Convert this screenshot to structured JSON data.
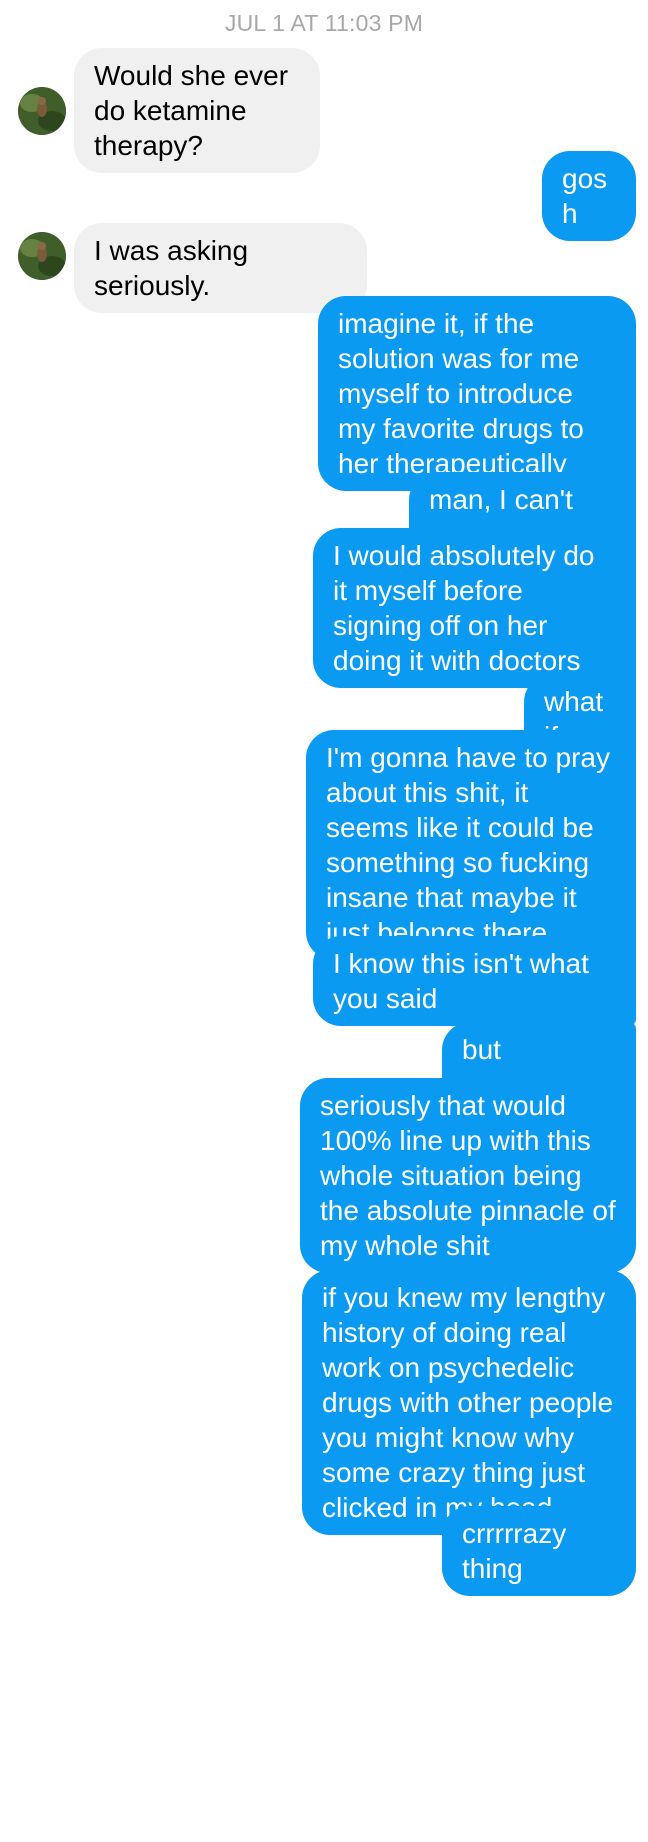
{
  "timestamp": "JUL 1 AT 11:03 PM",
  "colors": {
    "sent_bubble": "#0a9af2",
    "received_bubble": "#f0f0f0",
    "timestamp_text": "#a8a8a8"
  },
  "messages": [
    {
      "from": "them",
      "text": "Would she ever do ketamine therapy?"
    },
    {
      "from": "me",
      "text": "gosh"
    },
    {
      "from": "them",
      "text": "I was asking seriously."
    },
    {
      "from": "me",
      "text": "imagine it, if the solution was for me myself to introduce my favorite drugs to her therapeutically"
    },
    {
      "from": "me",
      "text": "man, I can't even"
    },
    {
      "from": "me",
      "text": "I would absolutely do it myself before signing off on her doing it with doctors"
    },
    {
      "from": "me",
      "text": "what if"
    },
    {
      "from": "me",
      "text": "I'm gonna have to pray about this shit, it seems like it could be something so fucking insane that maybe it just belongs there"
    },
    {
      "from": "me",
      "text": "I know this isn't what you said"
    },
    {
      "from": "me",
      "text": "but yooooooo"
    },
    {
      "from": "me",
      "text": "seriously that would 100% line up with this whole situation being the absolute pinnacle of my whole shit"
    },
    {
      "from": "me",
      "text": "if you knew my lengthy history of doing real work on psychedelic drugs with other people you might know why some crazy thing just clicked in my head"
    },
    {
      "from": "me",
      "text": "crrrrrazy thing"
    }
  ]
}
